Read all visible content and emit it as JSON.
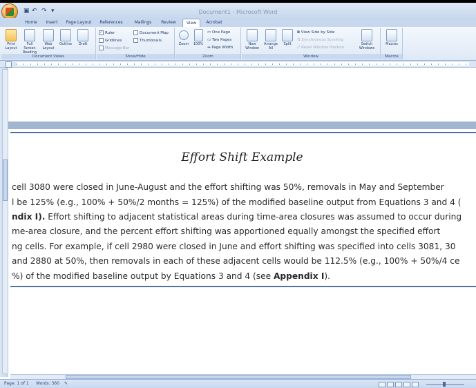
{
  "window": {
    "title": "Document1 - Microsoft Word"
  },
  "quick_access": {
    "undo_label": "↶",
    "redo_label": "↷"
  },
  "tabs": [
    {
      "label": "Home"
    },
    {
      "label": "Insert"
    },
    {
      "label": "Page Layout"
    },
    {
      "label": "References"
    },
    {
      "label": "Mailings"
    },
    {
      "label": "Review"
    },
    {
      "label": "View"
    },
    {
      "label": "Acrobat"
    }
  ],
  "ribbon": {
    "document_views": {
      "label": "Document Views",
      "buttons": [
        {
          "label": "Print Layout"
        },
        {
          "label": "Full Screen Reading"
        },
        {
          "label": "Web Layout"
        },
        {
          "label": "Outline"
        },
        {
          "label": "Draft"
        }
      ]
    },
    "show_hide": {
      "label": "Show/Hide",
      "items": [
        {
          "label": "Ruler",
          "checked": true
        },
        {
          "label": "Gridlines",
          "checked": false
        },
        {
          "label": "Message Bar",
          "checked": false
        },
        {
          "label": "Document Map",
          "checked": false
        },
        {
          "label": "Thumbnails",
          "checked": false
        }
      ]
    },
    "zoom": {
      "label": "Zoom",
      "zoom_button": "Zoom",
      "percent_button": "100%",
      "one_page": "One Page",
      "two_pages": "Two Pages",
      "page_width": "Page Width"
    },
    "window": {
      "label": "Window",
      "new_window": "New Window",
      "arrange_all": "Arrange All",
      "split": "Split",
      "view_side_by_side": "View Side by Side",
      "sync_scrolling": "Synchronous Scrolling",
      "reset_position": "Reset Window Position",
      "switch_windows": "Switch Windows"
    },
    "macros": {
      "label": "Macros",
      "button": "Macros"
    }
  },
  "document": {
    "title": "Effort Shift Example",
    "lines": [
      {
        "text": "cell 3080 were closed in June-August and the effort shifting was 50%, removals in May and September"
      },
      {
        "text": "l be 125% (e.g., 100% + 50%/2 months = 125%) of the modified baseline output from Equations 3 and 4 ("
      },
      {
        "bold_prefix": "ndix I).",
        "text": " Effort shifting to adjacent statistical areas during time-area closures was assumed to occur during"
      },
      {
        "text": "me-area closure, and the percent effort shifting was apportioned equally amongst the specified effort"
      },
      {
        "text": "ng cells.  For example, if cell 2980 were closed in June and effort shifting was specified into cells 3081, 30"
      },
      {
        "text": " and 2880 at 50%, then removals in each of these adjacent cells would be 112.5% (e.g., 100% + 50%/4 ce"
      },
      {
        "text": "%) of the modified baseline output by Equations 3 and 4 (see ",
        "bold_suffix": "Appendix I",
        "end": ")."
      }
    ]
  },
  "statusbar": {
    "page": "Page: 1 of 1",
    "words": "Words: 360"
  }
}
